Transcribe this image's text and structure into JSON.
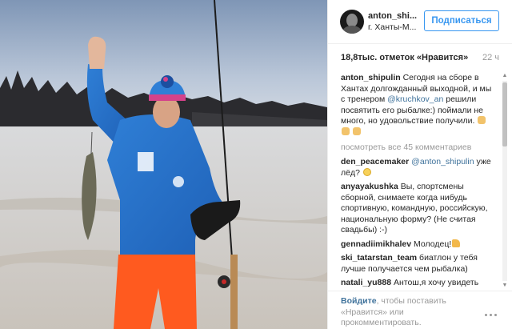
{
  "header": {
    "username": "anton_shi...",
    "location": "г. Ханты-М...",
    "follow_label": "Подписаться"
  },
  "likes": {
    "count": "18,8тыс. отметок «Нравится»",
    "time": "22 ч"
  },
  "caption": {
    "author": "anton_shipulin",
    "text_before": " Сегодня на сборе в Хантах долгожданный выходной, и мы с тренером ",
    "mention": "@kruchkov_an",
    "text_after": " решили посвятить его рыбалке:) поймали не много, но удовольствие получили. "
  },
  "view_all": "посмотреть все 45 комментариев",
  "comments": [
    {
      "author": "den_peacemaker",
      "mention": "@anton_shipulin",
      "text": " уже лёд?"
    },
    {
      "author": "anyayakushka",
      "mention": "",
      "text": " Вы, спортсмены сборной, снимаете когда нибудь спортивную, командную, российскую, национальную форму? (Не считая свадьбы) :-)"
    },
    {
      "author": "gennadiimikhalev",
      "mention": "",
      "text": " Молодец!"
    },
    {
      "author": "ski_tatarstan_team",
      "mention": "",
      "text": " биатлон у тебя лучше получается чем рыбалка)"
    },
    {
      "author": "natali_yu888",
      "mention": "",
      "text": " Антош,я хочу увидеть тебя в живую "
    }
  ],
  "footer": {
    "login": "Войдите",
    "text": ", чтобы поставить «Нравится» или прокомментировать."
  },
  "icons": {
    "follow_color": "#3897f0",
    "link_color": "#3f729b"
  }
}
